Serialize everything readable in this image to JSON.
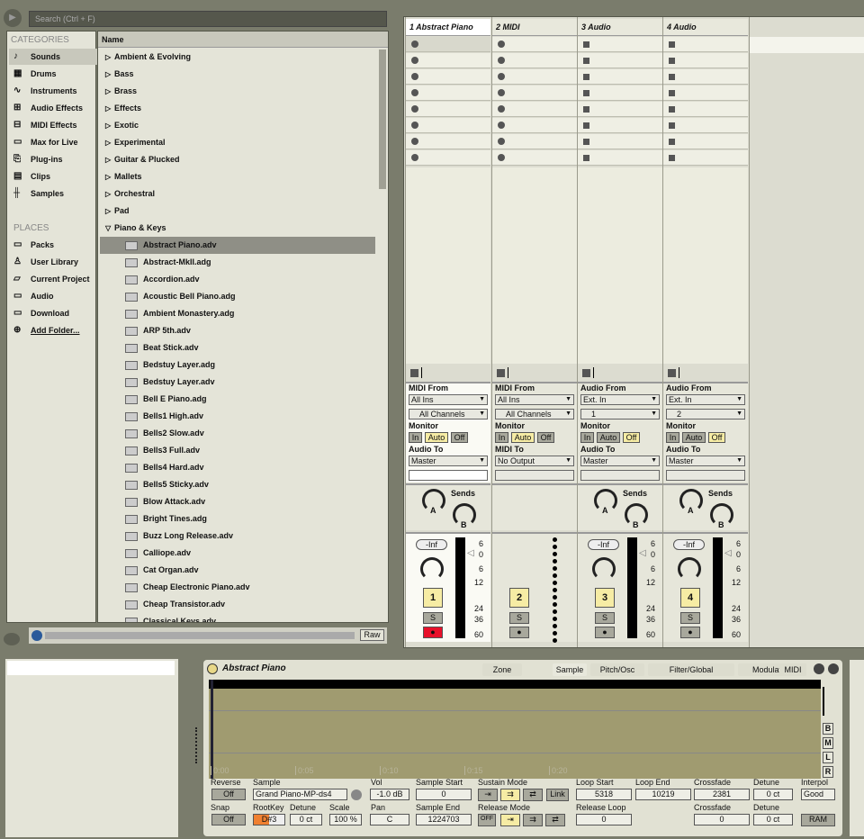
{
  "browser": {
    "search_placeholder": "Search (Ctrl + F)",
    "categories_title": "CATEGORIES",
    "categories": [
      {
        "label": "Sounds",
        "icon": "note-icon"
      },
      {
        "label": "Drums",
        "icon": "grid-icon"
      },
      {
        "label": "Instruments",
        "icon": "wave-icon"
      },
      {
        "label": "Audio Effects",
        "icon": "audio-fx-icon"
      },
      {
        "label": "MIDI Effects",
        "icon": "midi-fx-icon"
      },
      {
        "label": "Max for Live",
        "icon": "max-icon"
      },
      {
        "label": "Plug-ins",
        "icon": "plugin-icon"
      },
      {
        "label": "Clips",
        "icon": "clip-icon"
      },
      {
        "label": "Samples",
        "icon": "sample-icon"
      }
    ],
    "places_title": "PLACES",
    "places": [
      {
        "label": "Packs",
        "icon": "packs-icon"
      },
      {
        "label": "User Library",
        "icon": "user-icon"
      },
      {
        "label": "Current Project",
        "icon": "project-icon"
      },
      {
        "label": "Audio",
        "icon": "folder-icon"
      },
      {
        "label": "Download",
        "icon": "folder-icon"
      },
      {
        "label": "Add Folder...",
        "icon": "add-icon"
      }
    ],
    "name_header": "Name",
    "folders": [
      "Ambient & Evolving",
      "Bass",
      "Brass",
      "Effects",
      "Exotic",
      "Experimental",
      "Guitar & Plucked",
      "Mallets",
      "Orchestral",
      "Pad",
      "Piano & Keys"
    ],
    "files": [
      "Abstract Piano.adv",
      "Abstract-MkII.adg",
      "Accordion.adv",
      "Acoustic Bell Piano.adg",
      "Ambient Monastery.adg",
      "ARP 5th.adv",
      "Beat Stick.adv",
      "Bedstuy Layer.adg",
      "Bedstuy Layer.adv",
      "Bell E Piano.adg",
      "Bells1 High.adv",
      "Bells2 Slow.adv",
      "Bells3 Full.adv",
      "Bells4 Hard.adv",
      "Bells5 Sticky.adv",
      "Blow Attack.adv",
      "Bright Tines.adg",
      "Buzz Long Release.adv",
      "Calliope.adv",
      "Cat Organ.adv",
      "Cheap Electronic Piano.adv",
      "Cheap Transistor.adv",
      "Classical Keys.adv"
    ],
    "preview_raw": "Raw"
  },
  "tracks": [
    {
      "name": "1 Abstract Piano",
      "type": "midi",
      "from_label": "MIDI From",
      "from": "All Ins",
      "channel": "All Channels",
      "monitor": "Auto",
      "to_label": "Audio To",
      "to": "Master",
      "has_sends": true,
      "vol": "-Inf",
      "num": "1"
    },
    {
      "name": "2 MIDI",
      "type": "midi",
      "from_label": "MIDI From",
      "from": "All Ins",
      "channel": "All Channels",
      "monitor": "Auto",
      "to_label": "MIDI To",
      "to": "No Output",
      "has_sends": false,
      "vol": "",
      "num": "2"
    },
    {
      "name": "3 Audio",
      "type": "audio",
      "from_label": "Audio From",
      "from": "Ext. In",
      "channel": "1",
      "monitor": "Off",
      "to_label": "Audio To",
      "to": "Master",
      "has_sends": true,
      "vol": "-Inf",
      "num": "3"
    },
    {
      "name": "4 Audio",
      "type": "audio",
      "from_label": "Audio From",
      "from": "Ext. In",
      "channel": "2",
      "monitor": "Off",
      "to_label": "Audio To",
      "to": "Master",
      "has_sends": true,
      "vol": "-Inf",
      "num": "4"
    }
  ],
  "mixer": {
    "monitor_label": "Monitor",
    "monitor_opts": [
      "In",
      "Auto",
      "Off"
    ],
    "sends_label": "Sends",
    "send_a": "A",
    "send_b": "B",
    "solo": "S",
    "meter_scale": [
      "6",
      "0",
      "6",
      "12",
      "24",
      "36",
      "60"
    ]
  },
  "device": {
    "title": "Abstract Piano",
    "tabs": [
      "Zone",
      "Sample",
      "Pitch/Osc",
      "Filter/Global",
      "Modulation",
      "MIDI"
    ],
    "side_buttons": [
      "B",
      "M",
      "L",
      "R"
    ],
    "time_ticks": [
      "0:00",
      "0:05",
      "0:10",
      "0:15",
      "0:20"
    ],
    "reverse_label": "Reverse",
    "reverse": "Off",
    "snap_label": "Snap",
    "snap": "Off",
    "sample_label": "Sample",
    "sample": "Grand Piano-MP-ds4",
    "rootkey_label": "RootKey",
    "rootkey": "D#3",
    "detune_label": "Detune",
    "detune": "0 ct",
    "scale_label": "Scale",
    "scale": "100 %",
    "vol_label": "Vol",
    "vol": "-1.0 dB",
    "pan_label": "Pan",
    "pan": "C",
    "sample_start_label": "Sample Start",
    "sample_start": "0",
    "sample_end_label": "Sample End",
    "sample_end": "1224703",
    "sustain_label": "Sustain Mode",
    "link": "Link",
    "release_label": "Release Mode",
    "release_off": "OFF",
    "loop_start_label": "Loop Start",
    "loop_start": "5318",
    "loop_end_label": "Loop End",
    "loop_end": "10219",
    "release_loop_label": "Release Loop",
    "release_loop": "0",
    "crossfade_label": "Crossfade",
    "crossfade": "2381",
    "crossfade2": "0",
    "detune2_label": "Detune",
    "detune2": "0 ct",
    "detune3": "0 ct",
    "interpol_label": "Interpol",
    "interpol": "Good",
    "ram": "RAM"
  }
}
